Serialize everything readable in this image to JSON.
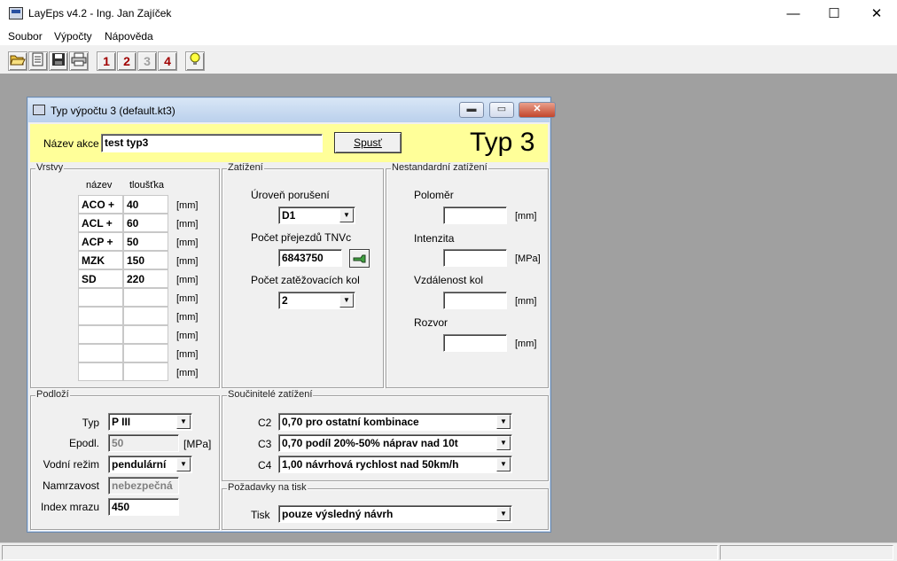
{
  "app": {
    "title": "LayEps v4.2 - Ing. Jan Zajíček"
  },
  "window_controls": {
    "minimize": "—",
    "maximize": "☐",
    "close": "✕"
  },
  "menu": [
    "Soubor",
    "Výpočty",
    "Nápověda"
  ],
  "toolbar": {
    "icons": [
      "open-icon",
      "print-preview-icon",
      "save-icon",
      "print-icon"
    ],
    "numbers": [
      "1",
      "2",
      "3",
      "4"
    ],
    "bulb": "💡"
  },
  "child": {
    "title": "Typ výpočtu 3 (default.kt3)",
    "controls": {
      "minimize": "▬",
      "maximize": "▭",
      "close": "✕"
    },
    "nazev_label": "Název akce",
    "nazev_value": "test typ3",
    "spust": "Spusť",
    "typ_label": "Typ 3",
    "vrstvy": {
      "title": "Vrstvy",
      "col_nazev": "název",
      "col_tloustka": "tloušťka",
      "unit": "[mm]",
      "rows": [
        {
          "nazev": "ACO +",
          "tloustka": "40"
        },
        {
          "nazev": "ACL +",
          "tloustka": "60"
        },
        {
          "nazev": "ACP +",
          "tloustka": "50"
        },
        {
          "nazev": "MZK",
          "tloustka": "150"
        },
        {
          "nazev": "SD",
          "tloustka": "220"
        },
        {
          "nazev": "",
          "tloustka": ""
        },
        {
          "nazev": "",
          "tloustka": ""
        },
        {
          "nazev": "",
          "tloustka": ""
        },
        {
          "nazev": "",
          "tloustka": ""
        },
        {
          "nazev": "",
          "tloustka": ""
        }
      ]
    },
    "zatizeni": {
      "title": "Zatížení",
      "uroven_label": "Úroveň porušení",
      "uroven_value": "D1",
      "prejezdy_label": "Počet přejezdů TNVc",
      "prejezdy_value": "6843750",
      "kola_label": "Počet zatěžovacích kol",
      "kola_value": "2"
    },
    "nestandardni": {
      "title": "Nestandardní zatížení",
      "polomer_label": "Poloměr",
      "polomer_unit": "[mm]",
      "intenzita_label": "Intenzita",
      "intenzita_unit": "[MPa]",
      "vzdalenost_label": "Vzdálenost kol",
      "vzdalenost_unit": "[mm]",
      "rozvor_label": "Rozvor",
      "rozvor_unit": "[mm]"
    },
    "podlozi": {
      "title": "Podloží",
      "typ_label": "Typ",
      "typ_value": "P III",
      "epodl_label": "Epodl.",
      "epodl_value": "50",
      "epodl_unit": "[MPa]",
      "vodni_label": "Vodní režim",
      "vodni_value": "pendulární",
      "namrz_label": "Namrzavost",
      "namrz_value": "nebezpečná",
      "index_label": "Index mrazu",
      "index_value": "450"
    },
    "soucinitele": {
      "title": "Součinitelé zatížení",
      "c2_label": "C2",
      "c2_value": "0,70 pro ostatní kombinace",
      "c3_label": "C3",
      "c3_value": "0,70 podíl 20%-50% náprav nad 10t",
      "c4_label": "C4",
      "c4_value": "1,00 návrhová rychlost nad 50km/h"
    },
    "tisk": {
      "title": "Požadavky na tisk",
      "label": "Tisk",
      "value": "pouze výsledný návrh"
    }
  }
}
